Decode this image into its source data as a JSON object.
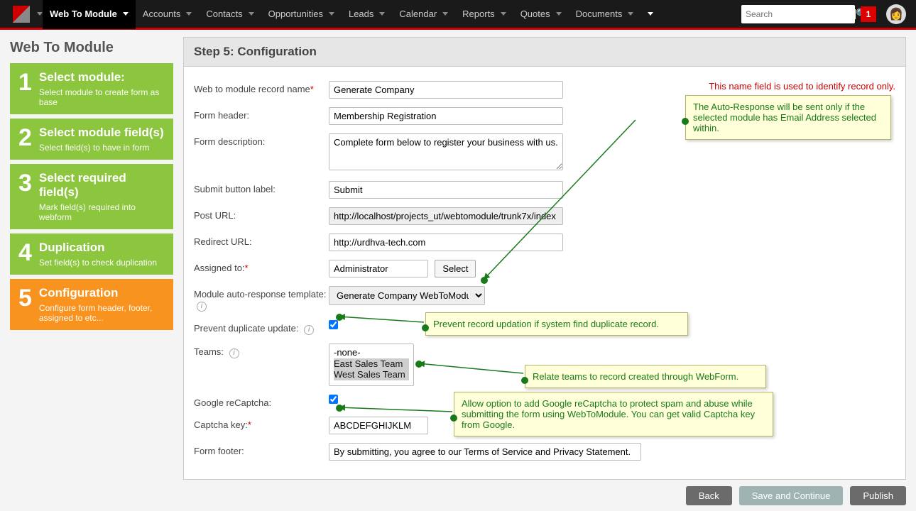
{
  "nav": {
    "items": [
      "Web To Module",
      "Accounts",
      "Contacts",
      "Opportunities",
      "Leads",
      "Calendar",
      "Reports",
      "Quotes",
      "Documents"
    ],
    "active": "Web To Module",
    "search_placeholder": "Search",
    "notif_count": "1"
  },
  "page_title": "Web To Module",
  "wizard": [
    {
      "num": "1",
      "title": "Select module:",
      "desc": "Select module to create form as base",
      "color": "green"
    },
    {
      "num": "2",
      "title": "Select module field(s)",
      "desc": "Select field(s) to have in form",
      "color": "green"
    },
    {
      "num": "3",
      "title": "Select required field(s)",
      "desc": "Mark field(s) required into webform",
      "color": "green"
    },
    {
      "num": "4",
      "title": "Duplication",
      "desc": "Set field(s) to check duplication",
      "color": "green"
    },
    {
      "num": "5",
      "title": "Configuration",
      "desc": "Configure form header, footer, assigned to etc...",
      "color": "orange"
    }
  ],
  "panel": {
    "heading": "Step 5: Configuration",
    "labels": {
      "record_name": "Web to module record name",
      "form_header": "Form header:",
      "form_description": "Form description:",
      "submit_label": "Submit button label:",
      "post_url": "Post URL:",
      "redirect_url": "Redirect URL:",
      "assigned_to": "Assigned to:",
      "auto_response": "Module auto-response template:",
      "prevent_dup": "Prevent duplicate update:",
      "teams": "Teams:",
      "recaptcha": "Google reCaptcha:",
      "captcha_key": "Captcha key:",
      "form_footer": "Form footer:"
    },
    "values": {
      "record_name": "Generate Company",
      "form_header": "Membership Registration",
      "form_description": "Complete form below to register your business with us.",
      "submit_label": "Submit",
      "post_url": "http://localhost/projects_ut/webtomodule/trunk7x/index",
      "redirect_url": "http://urdhva-tech.com",
      "assigned_to": "Administrator",
      "auto_response": "Generate Company WebToModule",
      "prevent_dup": true,
      "teams_options": [
        "-none-",
        "East Sales Team",
        "West Sales Team"
      ],
      "teams_selected": [
        "East Sales Team",
        "West Sales Team"
      ],
      "recaptcha": true,
      "captcha_key": "ABCDEFGHIJKLM",
      "form_footer": "By submitting, you agree to our Terms of Service and Privacy Statement."
    },
    "select_button": "Select",
    "name_hint": "This name field is used to identify record only."
  },
  "callouts": {
    "auto_response": "The Auto-Response will be sent only if the selected module has Email Address selected within.",
    "prevent_dup": "Prevent record updation if system find duplicate record.",
    "teams": "Relate teams to record created through WebForm.",
    "recaptcha": "Allow option to add Google reCaptcha to protect spam and abuse while submitting the form using WebToModule. You can get valid Captcha key from Google."
  },
  "footer": {
    "back": "Back",
    "save": "Save and Continue",
    "publish": "Publish"
  }
}
